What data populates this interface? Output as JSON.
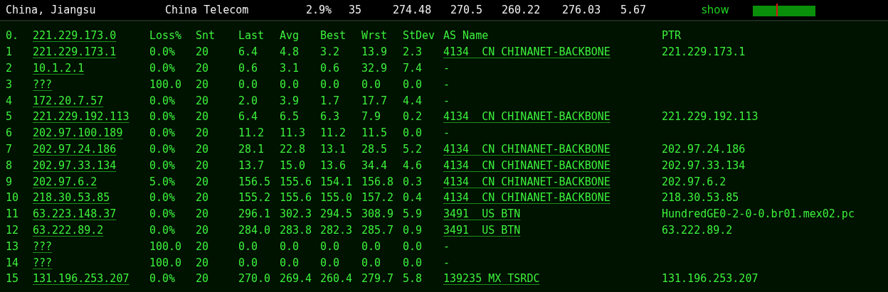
{
  "summary": {
    "location": "China, Jiangsu",
    "isp": "China Telecom",
    "loss": "2.9%",
    "count": "35",
    "last": "274.48",
    "avg": "270.5",
    "best": "260.22",
    "worst": "276.03",
    "stdev": "5.67",
    "toggle": "show"
  },
  "table": {
    "columns": {
      "index": "0.",
      "host": "221.229.173.0",
      "loss": "Loss%",
      "snt": "Snt",
      "last": "Last",
      "avg": "Avg",
      "best": "Best",
      "wrst": "Wrst",
      "stdev": "StDev",
      "as_name": "AS Name",
      "ptr": "PTR"
    },
    "rows": [
      {
        "index": "1",
        "host": "221.229.173.1",
        "loss": "0.0%",
        "snt": "20",
        "last": "6.4",
        "avg": "4.8",
        "best": "3.2",
        "wrst": "13.9",
        "stdev": "2.3",
        "as_name": "4134  CN CHINANET-BACKBONE",
        "as_linked": true,
        "ptr": "221.229.173.1"
      },
      {
        "index": "2",
        "host": "10.1.2.1",
        "loss": "0.0%",
        "snt": "20",
        "last": "0.6",
        "avg": "3.1",
        "best": "0.6",
        "wrst": "32.9",
        "stdev": "7.4",
        "as_name": "-",
        "as_linked": false
      },
      {
        "index": "3",
        "host": "???",
        "loss": "100.0",
        "snt": "20",
        "last": "0.0",
        "avg": "0.0",
        "best": "0.0",
        "wrst": "0.0",
        "stdev": "0.0",
        "as_name": "-",
        "as_linked": false
      },
      {
        "index": "4",
        "host": "172.20.7.57",
        "loss": "0.0%",
        "snt": "20",
        "last": "2.0",
        "avg": "3.9",
        "best": "1.7",
        "wrst": "17.7",
        "stdev": "4.4",
        "as_name": "-",
        "as_linked": false
      },
      {
        "index": "5",
        "host": "221.229.192.113",
        "loss": "0.0%",
        "snt": "20",
        "last": "6.4",
        "avg": "6.5",
        "best": "6.3",
        "wrst": "7.9",
        "stdev": "0.2",
        "as_name": "4134  CN CHINANET-BACKBONE",
        "as_linked": true,
        "ptr": "221.229.192.113"
      },
      {
        "index": "6",
        "host": "202.97.100.189",
        "loss": "0.0%",
        "snt": "20",
        "last": "11.2",
        "avg": "11.3",
        "best": "11.2",
        "wrst": "11.5",
        "stdev": "0.0",
        "as_name": "-",
        "as_linked": false
      },
      {
        "index": "7",
        "host": "202.97.24.186",
        "loss": "0.0%",
        "snt": "20",
        "last": "28.1",
        "avg": "22.8",
        "best": "13.1",
        "wrst": "28.5",
        "stdev": "5.2",
        "as_name": "4134  CN CHINANET-BACKBONE",
        "as_linked": true,
        "ptr": "202.97.24.186"
      },
      {
        "index": "8",
        "host": "202.97.33.134",
        "loss": "0.0%",
        "snt": "20",
        "last": "13.7",
        "avg": "15.0",
        "best": "13.6",
        "wrst": "34.4",
        "stdev": "4.6",
        "as_name": "4134  CN CHINANET-BACKBONE",
        "as_linked": true,
        "ptr": "202.97.33.134"
      },
      {
        "index": "9",
        "host": "202.97.6.2",
        "loss": "5.0%",
        "snt": "20",
        "last": "156.5",
        "avg": "155.6",
        "best": "154.1",
        "wrst": "156.8",
        "stdev": "0.3",
        "as_name": "4134  CN CHINANET-BACKBONE",
        "as_linked": true,
        "ptr": "202.97.6.2"
      },
      {
        "index": "10",
        "host": "218.30.53.85",
        "loss": "0.0%",
        "snt": "20",
        "last": "155.2",
        "avg": "155.6",
        "best": "155.0",
        "wrst": "157.2",
        "stdev": "0.4",
        "as_name": "4134  CN CHINANET-BACKBONE",
        "as_linked": true,
        "ptr": "218.30.53.85"
      },
      {
        "index": "11",
        "host": "63.223.148.37",
        "loss": "0.0%",
        "snt": "20",
        "last": "296.1",
        "avg": "302.3",
        "best": "294.5",
        "wrst": "308.9",
        "stdev": "5.9",
        "as_name": "3491  US BTN",
        "as_linked": true,
        "ptr": "HundredGE0-2-0-0.br01.mex02.pc"
      },
      {
        "index": "12",
        "host": "63.222.89.2",
        "loss": "0.0%",
        "snt": "20",
        "last": "284.0",
        "avg": "283.8",
        "best": "282.3",
        "wrst": "285.7",
        "stdev": "0.9",
        "as_name": "3491  US BTN",
        "as_linked": true,
        "ptr": "63.222.89.2"
      },
      {
        "index": "13",
        "host": "???",
        "loss": "100.0",
        "snt": "20",
        "last": "0.0",
        "avg": "0.0",
        "best": "0.0",
        "wrst": "0.0",
        "stdev": "0.0",
        "as_name": "-",
        "as_linked": false
      },
      {
        "index": "14",
        "host": "???",
        "loss": "100.0",
        "snt": "20",
        "last": "0.0",
        "avg": "0.0",
        "best": "0.0",
        "wrst": "0.0",
        "stdev": "0.0",
        "as_name": "-",
        "as_linked": false
      },
      {
        "index": "15",
        "host": "131.196.253.207",
        "loss": "0.0%",
        "snt": "20",
        "last": "270.0",
        "avg": "269.4",
        "best": "260.4",
        "wrst": "279.7",
        "stdev": "5.8",
        "as_name": "139235 MX TSRDC",
        "as_linked": true,
        "ptr": "131.196.253.207"
      }
    ]
  }
}
